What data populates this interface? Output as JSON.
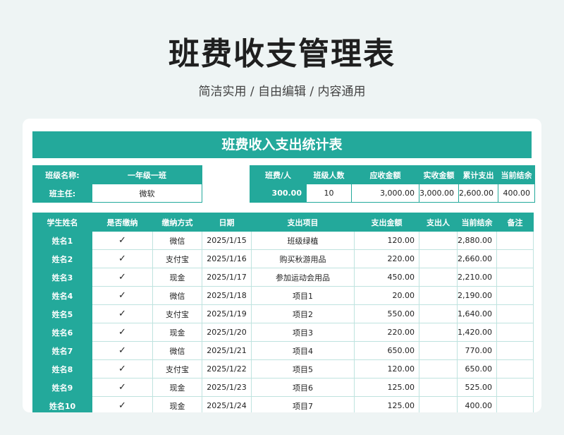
{
  "page": {
    "title": "班费收支管理表",
    "subtitle": "简洁实用 / 自由编辑 / 内容通用"
  },
  "sheet": {
    "banner": "班费收入支出统计表",
    "info_left": {
      "class_name_label": "班级名称:",
      "class_name_value": "一年级一班",
      "teacher_label": "班主任:",
      "teacher_value": "微软"
    },
    "summary": {
      "headers": [
        "班费/人",
        "班级人数",
        "应收金额",
        "实收金额",
        "累计支出",
        "当前结余"
      ],
      "values": [
        "300.00",
        "10",
        "3,000.00",
        "3,000.00",
        "2,600.00",
        "400.00"
      ]
    },
    "table": {
      "headers": [
        "学生姓名",
        "是否缴纳",
        "缴纳方式",
        "日期",
        "支出项目",
        "支出金额",
        "支出人",
        "当前结余",
        "备注"
      ],
      "rows": [
        {
          "name": "姓名1",
          "paid": "✓",
          "method": "微信",
          "date": "2025/1/15",
          "item": "班级绿植",
          "amount": "120.00",
          "payer": "",
          "balance": "2,880.00",
          "note": ""
        },
        {
          "name": "姓名2",
          "paid": "✓",
          "method": "支付宝",
          "date": "2025/1/16",
          "item": "购买秋游用品",
          "amount": "220.00",
          "payer": "",
          "balance": "2,660.00",
          "note": ""
        },
        {
          "name": "姓名3",
          "paid": "✓",
          "method": "现金",
          "date": "2025/1/17",
          "item": "参加运动会用品",
          "amount": "450.00",
          "payer": "",
          "balance": "2,210.00",
          "note": ""
        },
        {
          "name": "姓名4",
          "paid": "✓",
          "method": "微信",
          "date": "2025/1/18",
          "item": "项目1",
          "amount": "20.00",
          "payer": "",
          "balance": "2,190.00",
          "note": ""
        },
        {
          "name": "姓名5",
          "paid": "✓",
          "method": "支付宝",
          "date": "2025/1/19",
          "item": "项目2",
          "amount": "550.00",
          "payer": "",
          "balance": "1,640.00",
          "note": ""
        },
        {
          "name": "姓名6",
          "paid": "✓",
          "method": "现金",
          "date": "2025/1/20",
          "item": "项目3",
          "amount": "220.00",
          "payer": "",
          "balance": "1,420.00",
          "note": ""
        },
        {
          "name": "姓名7",
          "paid": "✓",
          "method": "微信",
          "date": "2025/1/21",
          "item": "项目4",
          "amount": "650.00",
          "payer": "",
          "balance": "770.00",
          "note": ""
        },
        {
          "name": "姓名8",
          "paid": "✓",
          "method": "支付宝",
          "date": "2025/1/22",
          "item": "项目5",
          "amount": "120.00",
          "payer": "",
          "balance": "650.00",
          "note": ""
        },
        {
          "name": "姓名9",
          "paid": "✓",
          "method": "现金",
          "date": "2025/1/23",
          "item": "项目6",
          "amount": "125.00",
          "payer": "",
          "balance": "525.00",
          "note": ""
        },
        {
          "name": "姓名10",
          "paid": "✓",
          "method": "现金",
          "date": "2025/1/24",
          "item": "项目7",
          "amount": "125.00",
          "payer": "",
          "balance": "400.00",
          "note": ""
        }
      ]
    }
  },
  "colors": {
    "accent": "#23a99b",
    "background": "#eef4f4"
  }
}
